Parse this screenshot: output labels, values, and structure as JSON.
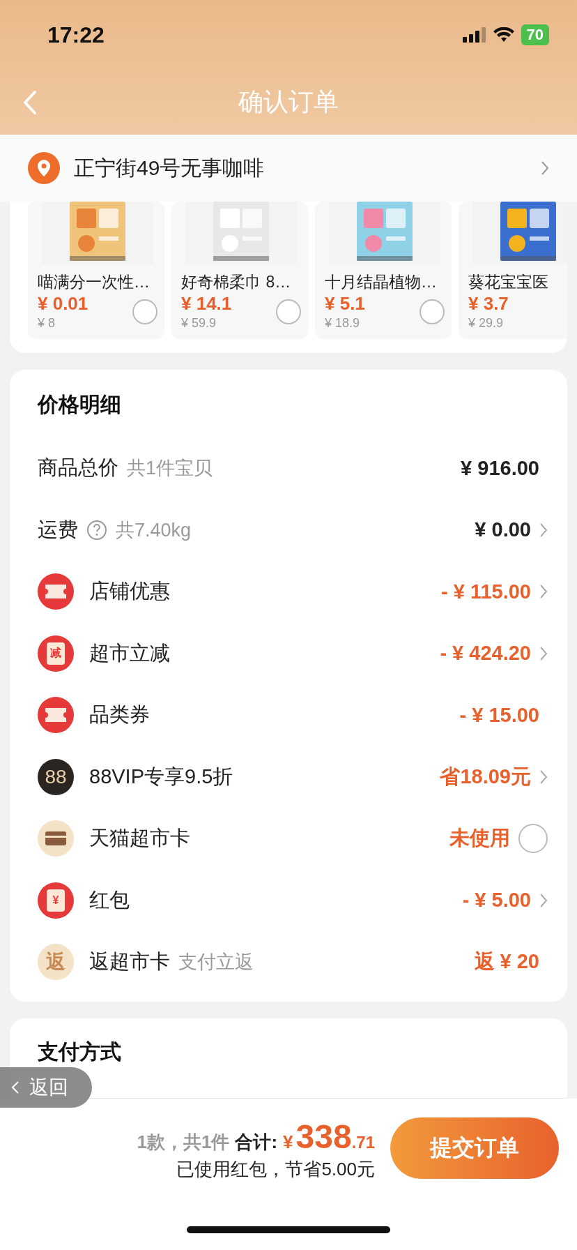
{
  "status_bar": {
    "time": "17:22",
    "battery": "70"
  },
  "nav": {
    "title": "确认订单"
  },
  "address": {
    "text": "正宁街49号无事咖啡"
  },
  "products": [
    {
      "name": "喵满分一次性…",
      "price": "¥ 0.01",
      "original_price": "¥ 8",
      "selected": false
    },
    {
      "name": "好奇棉柔巾 8…",
      "price": "¥ 14.1",
      "original_price": "¥ 59.9",
      "selected": false
    },
    {
      "name": "十月结晶植物…",
      "price": "¥ 5.1",
      "original_price": "¥ 18.9",
      "selected": false
    },
    {
      "name": "葵花宝宝医",
      "price": "¥ 3.7",
      "original_price": "¥ 29.9"
    }
  ],
  "price_detail": {
    "title": "价格明细",
    "rows": [
      {
        "kind": "plain",
        "label": "商品总价",
        "note": "共1件宝贝",
        "value": "¥ 916.00",
        "highlight": false,
        "chevron": false
      },
      {
        "kind": "plain",
        "label": "运费",
        "help": true,
        "note": "共7.40kg",
        "value": "¥ 0.00",
        "highlight": false,
        "chevron": true
      },
      {
        "kind": "ticket",
        "label": "店铺优惠",
        "value": "- ¥ 115.00",
        "highlight": true,
        "chevron": true
      },
      {
        "kind": "jian",
        "icon_text": "减",
        "label": "超市立减",
        "value": "- ¥ 424.20",
        "highlight": true,
        "chevron": true
      },
      {
        "kind": "ticket",
        "label": "品类券",
        "value": "- ¥ 15.00",
        "highlight": true,
        "chevron": false
      },
      {
        "kind": "vip",
        "icon_text": "88",
        "label": "88VIP专享9.5折",
        "value": "省18.09元",
        "highlight": true,
        "chevron": true
      },
      {
        "kind": "card",
        "label": "天猫超市卡",
        "value": "未使用",
        "highlight": true,
        "chevron": false,
        "radio": {
          "checked": false
        }
      },
      {
        "kind": "hongbao",
        "icon_text": "¥",
        "label": "红包",
        "value": "- ¥ 5.00",
        "highlight": true,
        "chevron": true
      },
      {
        "kind": "fan",
        "icon_text": "返",
        "label": "返超市卡",
        "note": "支付立返",
        "value": "返 ¥ 20",
        "highlight": true,
        "chevron": false
      }
    ]
  },
  "payment": {
    "title": "支付方式"
  },
  "float_back": {
    "label": "返回"
  },
  "bottom_bar": {
    "count": "1款，共1件",
    "total_label": "合计:",
    "currency": "¥",
    "total_int": "338",
    "total_dec": ".71",
    "saving": "已使用红包，节省5.00元",
    "submit": "提交订单"
  }
}
